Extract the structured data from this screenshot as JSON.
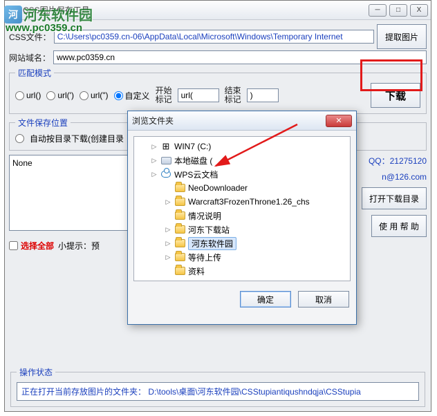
{
  "watermark": {
    "logo": "河",
    "text": "河东软件园",
    "url": "www.pc0359.cn"
  },
  "titlebar": {
    "title": "CSS图片保存工具"
  },
  "fields": {
    "css_label": "CSS文件：",
    "css_value": "C:\\Users\\pc0359.cn-06\\AppData\\Local\\Microsoft\\Windows\\Temporary Internet",
    "domain_label": "网站域名：",
    "domain_value": "www.pc0359.cn"
  },
  "buttons": {
    "extract": "提取图片",
    "download": "下载",
    "open_dir": "打开下载目录",
    "help": "使 用 帮 助"
  },
  "match": {
    "legend": "匹配模式",
    "r1": "url()",
    "r2": "url(')",
    "r3": "url(\")",
    "r4": "自定义",
    "start_label": "开始\n标记",
    "start_value": "url(",
    "end_label": "结束\n标记",
    "end_value": ")"
  },
  "save": {
    "legend": "文件保存位置",
    "radio": "自动按目录下载(创建目录"
  },
  "list": {
    "none": "None"
  },
  "contact": {
    "qq": "QQ：21275120",
    "mail": "n@126.com"
  },
  "check": {
    "selectall": "选择全部",
    "tip": "小提示：预"
  },
  "status": {
    "legend": "操作状态",
    "text": "正在打开当前存放图片的文件夹： D:\\tools\\桌面\\河东软件园\\CSStupiantiqushndqja\\CSStupia"
  },
  "dialog": {
    "title": "浏览文件夹",
    "ok": "确定",
    "cancel": "取消",
    "tree": [
      {
        "lvl": 1,
        "icon": "winflag",
        "label": "WIN7 (C:)",
        "exp": "▷"
      },
      {
        "lvl": 1,
        "icon": "drive",
        "label": "本地磁盘 (",
        "exp": "▷",
        "cut": true
      },
      {
        "lvl": 1,
        "icon": "cloud",
        "label": "WPS云文档",
        "exp": "▷"
      },
      {
        "lvl": 2,
        "icon": "folder",
        "label": "NeoDownloader",
        "exp": ""
      },
      {
        "lvl": 2,
        "icon": "folder",
        "label": "Warcraft3FrozenThrone1.26_chs",
        "exp": "▷"
      },
      {
        "lvl": 2,
        "icon": "folder",
        "label": "情况说明",
        "exp": ""
      },
      {
        "lvl": 2,
        "icon": "folder",
        "label": "河东下载站",
        "exp": "▷"
      },
      {
        "lvl": 2,
        "icon": "folder",
        "label": "河东软件园",
        "exp": "▷",
        "sel": true
      },
      {
        "lvl": 2,
        "icon": "folder",
        "label": "等待上传",
        "exp": "▷"
      },
      {
        "lvl": 2,
        "icon": "folder",
        "label": "资料",
        "exp": ""
      }
    ]
  }
}
